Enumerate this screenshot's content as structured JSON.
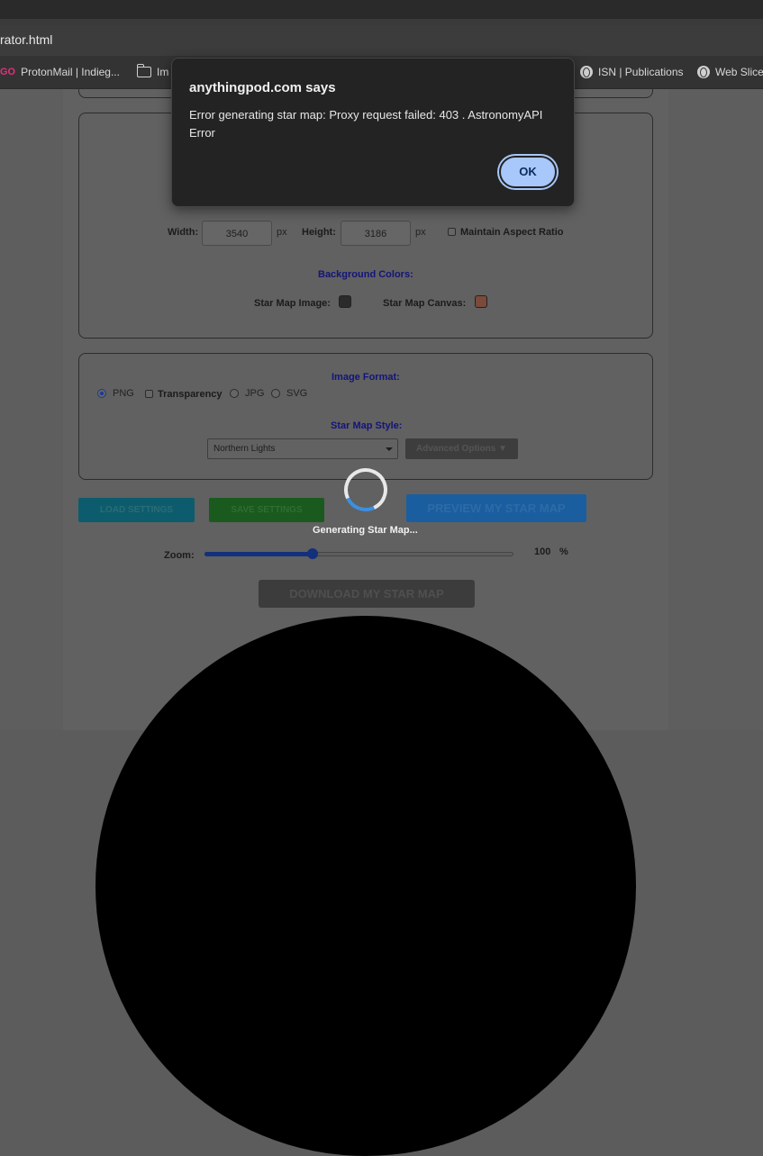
{
  "browser": {
    "address_text": "rator.html",
    "bookmarks": [
      {
        "prefix": "GO",
        "label": "ProtonMail | Indieg...",
        "icon": "go-icon"
      },
      {
        "label": "Im",
        "icon": "folder-icon"
      },
      {
        "label": "ISN | Publications",
        "icon": "globe-icon"
      },
      {
        "label": "Web Slice",
        "icon": "globe-icon"
      }
    ]
  },
  "dialog": {
    "title": "anythingpod.com says",
    "message": "Error generating star map: Proxy request failed: 403 . AstronomyAPI Error",
    "ok_label": "OK"
  },
  "dimensions": {
    "width_label": "Width:",
    "width_value": "3540",
    "height_label": "Height:",
    "height_value": "3186",
    "unit": "px",
    "aspect_label": "Maintain Aspect Ratio"
  },
  "background_colors": {
    "heading": "Background Colors:",
    "image_label": "Star Map Image:",
    "image_color": "#2b2b2b",
    "canvas_label": "Star Map Canvas:",
    "canvas_color": "#7a4a3a"
  },
  "format": {
    "heading": "Image Format:",
    "png_label": "PNG",
    "transparency_label": "Transparency",
    "jpg_label": "JPG",
    "svg_label": "SVG",
    "selected": "PNG"
  },
  "style": {
    "heading": "Star Map Style:",
    "selected": "Northern Lights",
    "advanced_label": "Advanced Options ▼"
  },
  "actions": {
    "load_label": "LOAD SETTINGS",
    "save_label": "SAVE SETTINGS",
    "preview_label": "PREVIEW MY STAR MAP",
    "download_label": "DOWNLOAD MY STAR MAP"
  },
  "status": {
    "generating_text": "Generating Star Map..."
  },
  "zoom": {
    "label": "Zoom:",
    "value": "100",
    "unit": "%",
    "slider_fraction": 0.35
  }
}
